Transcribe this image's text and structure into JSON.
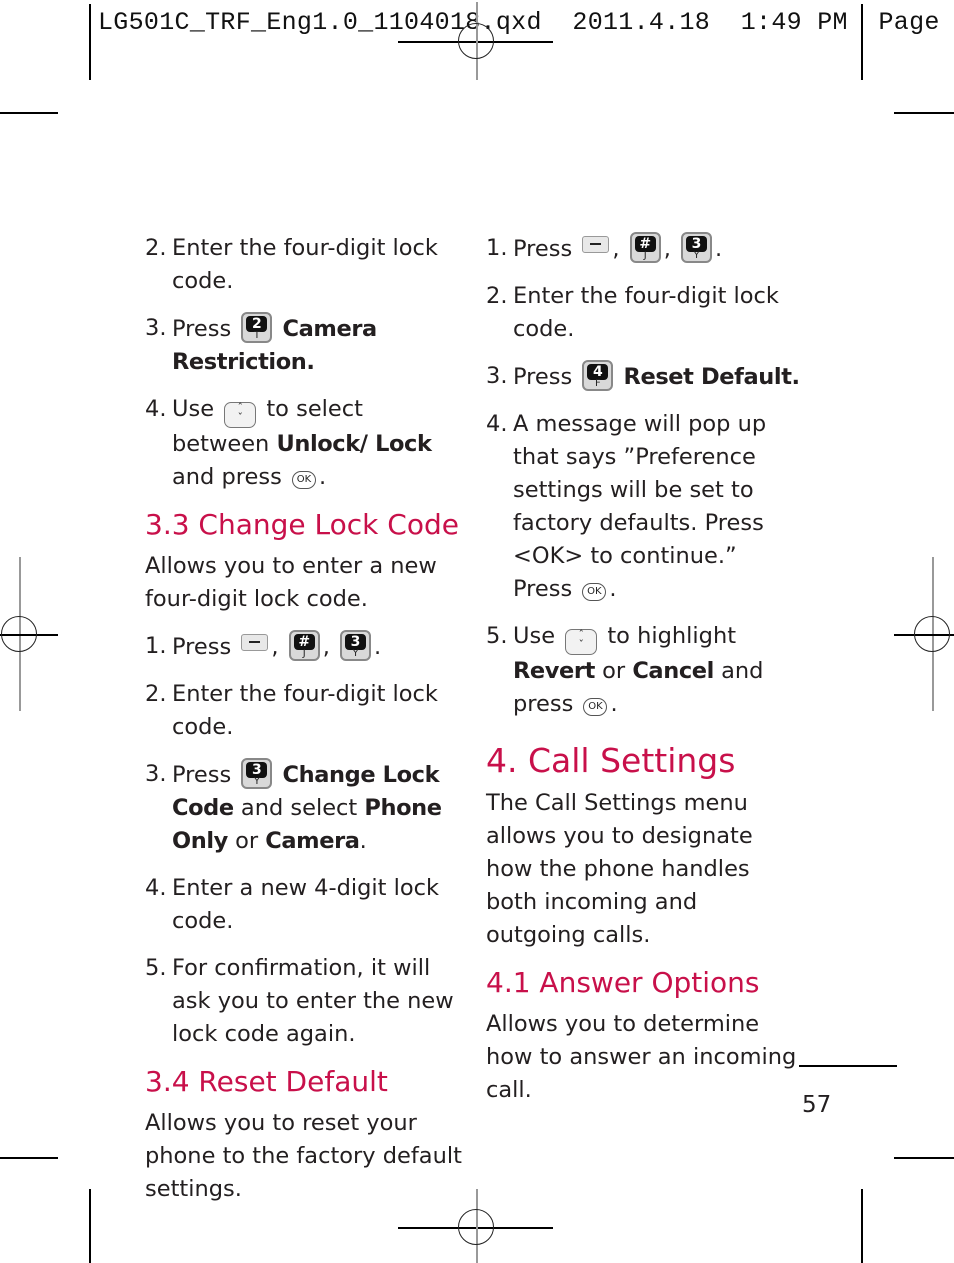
{
  "slug": {
    "file": "LG501C_TRF_Eng1.0_1104018.qxd",
    "date": "2011.4.18",
    "time": "1:49 PM",
    "page_label": "Page"
  },
  "left": {
    "steps_a": [
      {
        "num": "2.",
        "text": "Enter the four-digit lock code."
      },
      {
        "num": "3.",
        "pre": "Press",
        "key": {
          "main": "2",
          "sub": "T"
        },
        "bold": "Camera Restriction."
      },
      {
        "num": "4.",
        "pre": "Use",
        "mid": "to select between",
        "bold": "Unlock/ Lock",
        "post": "and press",
        "end": "."
      }
    ],
    "section_33": {
      "title": "3.3 Change Lock Code",
      "intro": "Allows you to enter a new four-digit lock code.",
      "steps": [
        {
          "num": "1.",
          "pre": "Press",
          "keys": [
            {
              "main": "#",
              "sub": "J"
            },
            {
              "main": "3",
              "sub": "Y"
            }
          ]
        },
        {
          "num": "2.",
          "text": "Enter the four-digit lock code."
        },
        {
          "num": "3.",
          "pre": "Press",
          "key": {
            "main": "3",
            "sub": "Y"
          },
          "bold1": "Change Lock Code",
          "mid": "and select",
          "bold2": "Phone Only",
          "or": "or",
          "bold3": "Camera",
          "end": "."
        },
        {
          "num": "4.",
          "text": "Enter a new 4-digit lock code."
        },
        {
          "num": "5.",
          "text": "For confirmation, it will ask you to enter the new lock code again."
        }
      ]
    },
    "section_34": {
      "title": "3.4 Reset Default",
      "intro": "Allows you to reset your phone to the factory default settings."
    }
  },
  "right": {
    "steps": [
      {
        "num": "1.",
        "pre": "Press",
        "keys": [
          {
            "main": "#",
            "sub": "J"
          },
          {
            "main": "3",
            "sub": "Y"
          }
        ]
      },
      {
        "num": "2.",
        "text": "Enter the four-digit lock code."
      },
      {
        "num": "3.",
        "pre": "Press",
        "key": {
          "main": "4",
          "sub": "F"
        },
        "bold": "Reset Default."
      },
      {
        "num": "4.",
        "text": "A message will pop up that says ”Preference settings will be set to factory defaults. Press <OK> to continue.”",
        "post": "Press",
        "end": "."
      },
      {
        "num": "5.",
        "pre": "Use",
        "mid": "to highlight",
        "bold1": "Revert",
        "or": "or",
        "bold2": "Cancel",
        "post": "and press",
        "end": "."
      }
    ],
    "chapter": {
      "title": "4. Call Settings",
      "intro": "The Call Settings menu allows you to designate how the phone handles both incoming and outgoing calls."
    },
    "section_41": {
      "title": "4.1 Answer Options",
      "intro": "Allows you to determine how to answer an incoming call."
    }
  },
  "keys": {
    "ok_label": "OK",
    "nav_up": "ˆ",
    "nav_down": "ˇ"
  },
  "page_number": "57",
  "colors": {
    "heading": "#c8104a",
    "text": "#231f20"
  }
}
